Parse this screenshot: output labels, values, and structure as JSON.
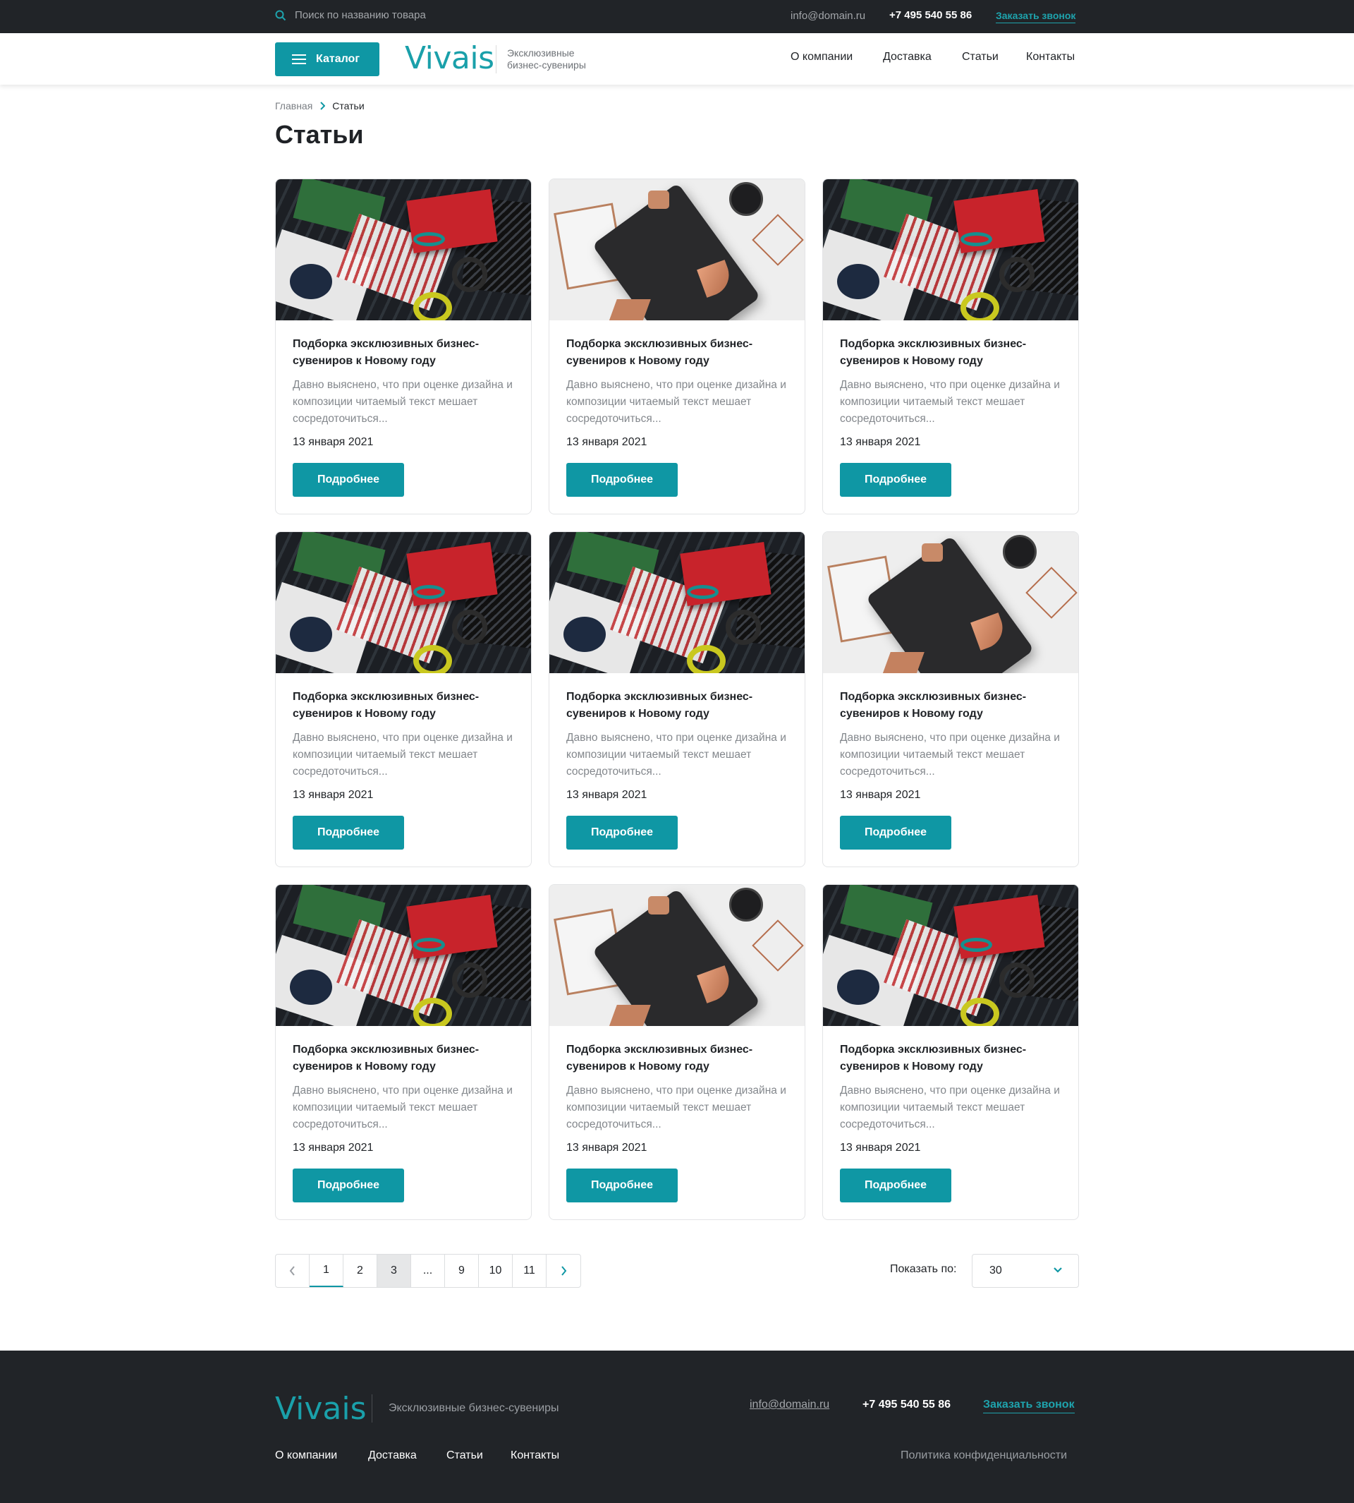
{
  "topbar": {
    "search_placeholder": "Поиск по названию товара",
    "email": "info@domain.ru",
    "phone": "+7 495 540 55 86",
    "callback": "Заказать звонок"
  },
  "header": {
    "catalog_label": "Каталог",
    "logo": "Vivais",
    "tagline": "Эксклюзивные бизнес-сувениры",
    "nav": [
      "О компании",
      "Доставка",
      "Статьи",
      "Контакты"
    ]
  },
  "breadcrumb": {
    "home": "Главная",
    "current": "Статьи"
  },
  "page_title": "Статьи",
  "articles": [
    {
      "image": "flatlay-dark",
      "title": "Подборка эксклюзивных бизнес-сувениров к Новому году",
      "excerpt": "Давно выяснено, что при оценке дизайна и композиции читаемый текст мешает сосредоточиться...",
      "date": "13 января 2021",
      "button": "Подробнее"
    },
    {
      "image": "clipboard-light",
      "title": "Подборка эксклюзивных бизнес-сувениров к Новому году",
      "excerpt": "Давно выяснено, что при оценке дизайна и композиции читаемый текст мешает сосредоточиться...",
      "date": "13 января 2021",
      "button": "Подробнее"
    },
    {
      "image": "flatlay-dark",
      "title": "Подборка эксклюзивных бизнес-сувениров к Новому году",
      "excerpt": "Давно выяснено, что при оценке дизайна и композиции читаемый текст мешает сосредоточиться...",
      "date": "13 января 2021",
      "button": "Подробнее"
    },
    {
      "image": "flatlay-dark",
      "title": "Подборка эксклюзивных бизнес-сувениров к Новому году",
      "excerpt": "Давно выяснено, что при оценке дизайна и композиции читаемый текст мешает сосредоточиться...",
      "date": "13 января 2021",
      "button": "Подробнее"
    },
    {
      "image": "flatlay-dark",
      "title": "Подборка эксклюзивных бизнес-сувениров к Новому году",
      "excerpt": "Давно выяснено, что при оценке дизайна и композиции читаемый текст мешает сосредоточиться...",
      "date": "13 января 2021",
      "button": "Подробнее"
    },
    {
      "image": "clipboard-light",
      "title": "Подборка эксклюзивных бизнес-сувениров к Новому году",
      "excerpt": "Давно выяснено, что при оценке дизайна и композиции читаемый текст мешает сосредоточиться...",
      "date": "13 января 2021",
      "button": "Подробнее"
    },
    {
      "image": "flatlay-dark",
      "title": "Подборка эксклюзивных бизнес-сувениров к Новому году",
      "excerpt": "Давно выяснено, что при оценке дизайна и композиции читаемый текст мешает сосредоточиться...",
      "date": "13 января 2021",
      "button": "Подробнее"
    },
    {
      "image": "clipboard-light",
      "title": "Подборка эксклюзивных бизнес-сувениров к Новому году",
      "excerpt": "Давно выяснено, что при оценке дизайна и композиции читаемый текст мешает сосредоточиться...",
      "date": "13 января 2021",
      "button": "Подробнее"
    },
    {
      "image": "flatlay-dark",
      "title": "Подборка эксклюзивных бизнес-сувениров к Новому году",
      "excerpt": "Давно выяснено, что при оценке дизайна и композиции читаемый текст мешает сосредоточиться...",
      "date": "13 января 2021",
      "button": "Подробнее"
    }
  ],
  "pagination": {
    "pages": [
      "1",
      "2",
      "3",
      "...",
      "9",
      "10",
      "11"
    ],
    "active": "1",
    "highlighted": "3",
    "prev_icon": "chevron-left-icon",
    "next_icon": "chevron-right-icon"
  },
  "show_by": {
    "label": "Показать по:",
    "value": "30"
  },
  "footer": {
    "logo": "Vivais",
    "tagline": "Эксклюзивные бизнес-сувениры",
    "email": "info@domain.ru",
    "phone": "+7 495 540 55 86",
    "callback": "Заказать звонок",
    "nav": [
      "О компании",
      "Доставка",
      "Статьи",
      "Контакты"
    ],
    "privacy": "Политика конфиденциальности"
  },
  "colors": {
    "accent": "#0f97a4",
    "dark": "#212428",
    "logo": "#1aa0aa"
  }
}
